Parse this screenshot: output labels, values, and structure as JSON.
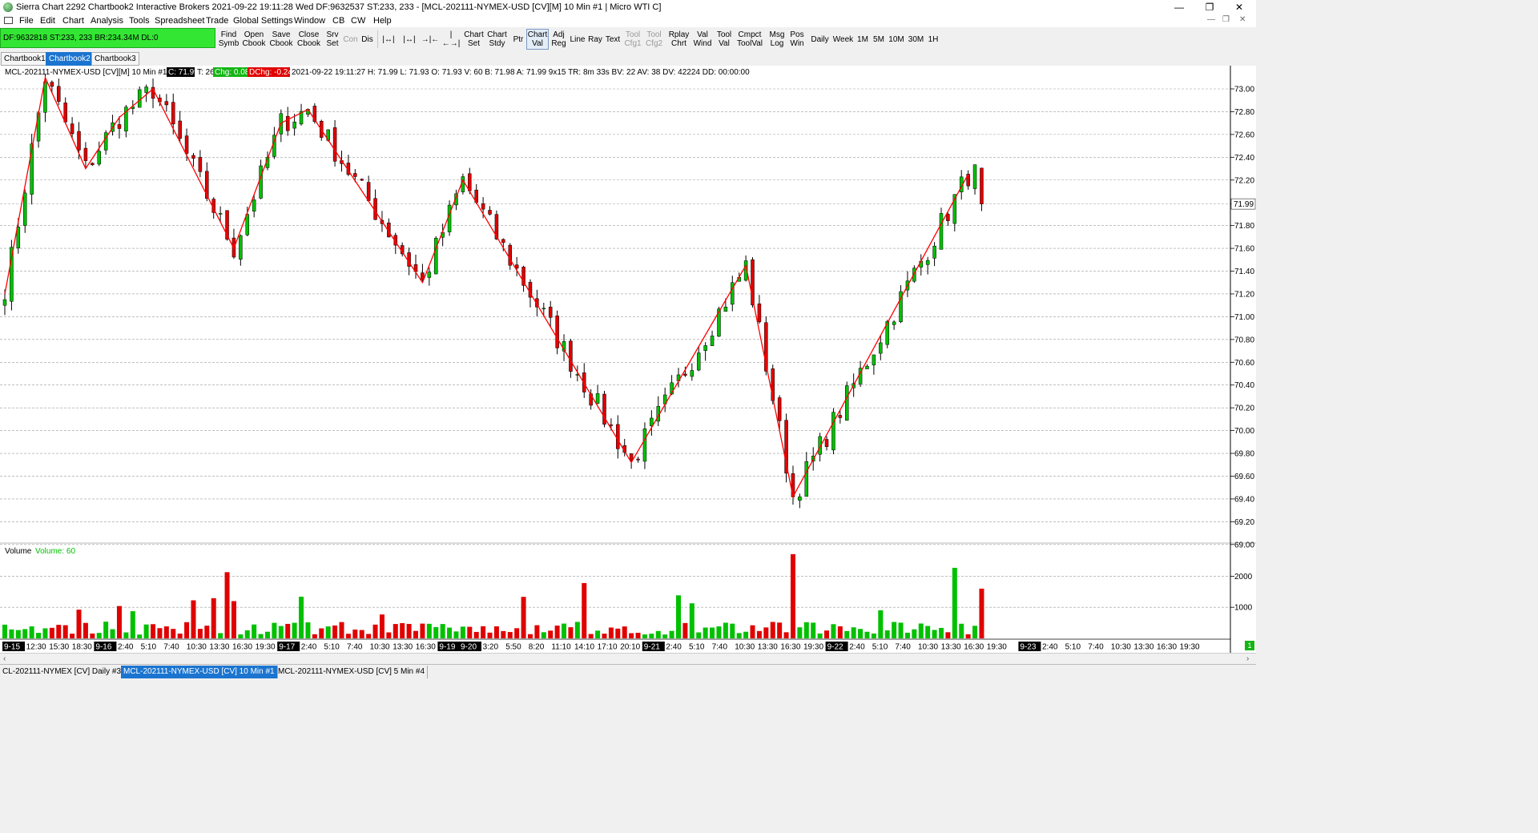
{
  "window": {
    "title": "Sierra Chart 2292 Chartbook2  Interactive Brokers 2021-09-22  19:11:28 Wed  DF:9632537  ST:233, 233  - [MCL-202111-NYMEX-USD [CV][M]  10 Min  #1 | Micro WTI C]",
    "minimize": "—",
    "restore": "❐",
    "close": "✕"
  },
  "menu": [
    "File",
    "Edit",
    "Chart",
    "Analysis",
    "Tools",
    "Spreadsheet",
    "Trade",
    "Global Settings",
    "Window",
    "CB",
    "CW",
    "Help"
  ],
  "menu_right": [
    "—",
    "❐",
    "✕"
  ],
  "status_box": "DF:9632818  ST:233, 233   BR:234.34M   DL:0",
  "toolbar": [
    {
      "id": "find-symb",
      "label": "Find\nSymb"
    },
    {
      "id": "open-cbook",
      "label": "Open\nCbook"
    },
    {
      "id": "save-cbook",
      "label": "Save\nCbook"
    },
    {
      "id": "close-cbook",
      "label": "Close\nCbook"
    },
    {
      "id": "srv-set",
      "label": "Srv\nSet"
    },
    {
      "id": "con",
      "label": "Con",
      "disabled": true
    },
    {
      "id": "dis",
      "label": "Dis"
    },
    {
      "id": "zoom-1",
      "label": "|↔|"
    },
    {
      "id": "zoom-2",
      "label": "|↔|"
    },
    {
      "id": "zoom-3",
      "label": "→|←"
    },
    {
      "id": "zoom-4",
      "label": "|←→|"
    },
    {
      "id": "chart-set",
      "label": "Chart\nSet"
    },
    {
      "id": "chart-stdy",
      "label": "Chart\nStdy"
    },
    {
      "id": "ptr",
      "label": "Ptr"
    },
    {
      "id": "chart-val",
      "label": "Chart\nVal",
      "selected": true
    },
    {
      "id": "adj-reg",
      "label": "Adj\nReg"
    },
    {
      "id": "line",
      "label": "Line"
    },
    {
      "id": "ray",
      "label": "Ray"
    },
    {
      "id": "text",
      "label": "Text"
    },
    {
      "id": "tool-cfg1",
      "label": "Tool\nCfg1",
      "disabled": true
    },
    {
      "id": "tool-cfg2",
      "label": "Tool\nCfg2",
      "disabled": true
    },
    {
      "id": "rplay-chrt",
      "label": "Rplay\nChrt"
    },
    {
      "id": "val-wind",
      "label": "Val\nWind"
    },
    {
      "id": "tool-val",
      "label": "Tool\nVal"
    },
    {
      "id": "cmpct-toolval",
      "label": "Cmpct\nToolVal"
    },
    {
      "id": "msg-log",
      "label": "Msg\nLog"
    },
    {
      "id": "pos-win",
      "label": "Pos\nWin"
    },
    {
      "id": "daily",
      "label": "Daily"
    },
    {
      "id": "week",
      "label": "Week"
    },
    {
      "id": "tf-1m",
      "label": "1M"
    },
    {
      "id": "tf-5m",
      "label": "5M"
    },
    {
      "id": "tf-10m",
      "label": "10M"
    },
    {
      "id": "tf-30m",
      "label": "30M"
    },
    {
      "id": "tf-1h",
      "label": "1H"
    }
  ],
  "chartbook_tabs": [
    {
      "label": "Chartbook1",
      "active": false
    },
    {
      "label": "Chartbook2",
      "active": true
    },
    {
      "label": "Chartbook3",
      "active": false
    }
  ],
  "chart_header": {
    "symbol": "MCL-202111-NYMEX-USD [CV][M]  10 Min   #1",
    "close": "C: 71.99",
    "ticks": "T: 26",
    "chg": "Chg: 0.08",
    "dchg": "DChg: -0.24",
    "details": "2021-09-22  19:11:27  H: 71.99  L: 71.93  O: 71.93  V: 60  B: 71.98  A: 71.99  9x15  TR: 8m 33s  BV: 22  AV: 38  DV: 42224  DD: 00:00:00"
  },
  "volume_header": {
    "label": "Volume",
    "value": "Volume: 60"
  },
  "colors": {
    "up": "#00c000",
    "down": "#e00000",
    "zigzag": "#ff0000",
    "grid": "#9a9a9a",
    "status_green": "#33e633",
    "active_tab": "#1b75d0"
  },
  "price_axis": [
    "73.00",
    "72.80",
    "72.60",
    "72.40",
    "72.20",
    "71.99",
    "71.80",
    "71.60",
    "71.40",
    "71.20",
    "71.00",
    "70.80",
    "70.60",
    "70.40",
    "70.20",
    "70.00",
    "69.80",
    "69.60",
    "69.40",
    "69.20",
    "69.00"
  ],
  "volume_axis": [
    "2000",
    "1000"
  ],
  "time_axis": [
    {
      "label": "9-15",
      "date": true
    },
    {
      "label": "12:30"
    },
    {
      "label": "15:30"
    },
    {
      "label": "18:30"
    },
    {
      "label": "9-16",
      "date": true
    },
    {
      "label": "2:40"
    },
    {
      "label": "5:10"
    },
    {
      "label": "7:40"
    },
    {
      "label": "10:30"
    },
    {
      "label": "13:30"
    },
    {
      "label": "16:30"
    },
    {
      "label": "19:30"
    },
    {
      "label": "9-17",
      "date": true
    },
    {
      "label": "2:40"
    },
    {
      "label": "5:10"
    },
    {
      "label": "7:40"
    },
    {
      "label": "10:30"
    },
    {
      "label": "13:30"
    },
    {
      "label": "16:30"
    },
    {
      "label": "9-19",
      "date": true
    },
    {
      "label": "9-20",
      "date": true
    },
    {
      "label": "3:20"
    },
    {
      "label": "5:50"
    },
    {
      "label": "8:20"
    },
    {
      "label": "11:10"
    },
    {
      "label": "14:10"
    },
    {
      "label": "17:10"
    },
    {
      "label": "20:10"
    },
    {
      "label": "9-21",
      "date": true
    },
    {
      "label": "2:40"
    },
    {
      "label": "5:10"
    },
    {
      "label": "7:40"
    },
    {
      "label": "10:30"
    },
    {
      "label": "13:30"
    },
    {
      "label": "16:30"
    },
    {
      "label": "19:30"
    },
    {
      "label": "9-22",
      "date": true
    },
    {
      "label": "2:40"
    },
    {
      "label": "5:10"
    },
    {
      "label": "7:40"
    },
    {
      "label": "10:30"
    },
    {
      "label": "13:30"
    },
    {
      "label": "16:30"
    },
    {
      "label": "19:30"
    },
    {
      "label": "9-23",
      "date": true
    },
    {
      "label": "2:40"
    },
    {
      "label": "5:10"
    },
    {
      "label": "7:40"
    },
    {
      "label": "10:30"
    },
    {
      "label": "13:30"
    },
    {
      "label": "16:30"
    },
    {
      "label": "19:30"
    }
  ],
  "corner_badge": "1",
  "bottom_tabs": [
    {
      "label": "CL-202111-NYMEX [CV]  Daily  #3",
      "active": false
    },
    {
      "label": "MCL-202111-NYMEX-USD [CV]  10 Min  #1",
      "active": true
    },
    {
      "label": "MCL-202111-NYMEX-USD [CV]  5 Min  #4",
      "active": false
    }
  ],
  "chart_data": {
    "type": "candlestick",
    "series": [
      {
        "name": "MCL-202111-NYMEX-USD [CV][M] 10 Min",
        "style": "ohlc-candles"
      },
      {
        "name": "Volume",
        "style": "bars"
      }
    ],
    "ylim": [
      69.0,
      73.1
    ],
    "volume_ylim": [
      0,
      2300
    ],
    "grid": true,
    "zigzag": [
      {
        "x_index": 0,
        "price": 71.2
      },
      {
        "x_index": 6,
        "price": 73.1
      },
      {
        "x_index": 12,
        "price": 72.3
      },
      {
        "x_index": 17,
        "price": 72.75
      },
      {
        "x_index": 22,
        "price": 73.0
      },
      {
        "x_index": 34,
        "price": 71.6
      },
      {
        "x_index": 41,
        "price": 72.7
      },
      {
        "x_index": 45,
        "price": 72.82
      },
      {
        "x_index": 62,
        "price": 71.3
      },
      {
        "x_index": 68,
        "price": 72.2
      },
      {
        "x_index": 93,
        "price": 69.72
      },
      {
        "x_index": 110,
        "price": 71.45
      },
      {
        "x_index": 117,
        "price": 69.42
      },
      {
        "x_index": 143,
        "price": 72.25
      }
    ],
    "last_close": 71.99
  }
}
